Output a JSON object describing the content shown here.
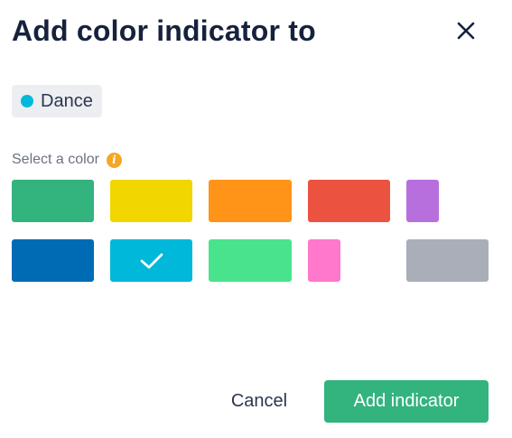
{
  "dialog": {
    "title": "Add color indicator to",
    "close_icon": "close-icon"
  },
  "tag": {
    "label": "Dance",
    "dot_color": "#00b8d9"
  },
  "color_section": {
    "label": "Select a color",
    "info_icon": "info-icon",
    "info_glyph": "i"
  },
  "colors": [
    {
      "name": "green",
      "hex": "#33b37e",
      "selected": false
    },
    {
      "name": "yellow",
      "hex": "#f2d600",
      "selected": false
    },
    {
      "name": "orange",
      "hex": "#ff9418",
      "selected": false
    },
    {
      "name": "red",
      "hex": "#eb5340",
      "selected": false
    },
    {
      "name": "purple",
      "hex": "#b86fde",
      "selected": false
    },
    {
      "name": "blue",
      "hex": "#006bb5",
      "selected": false
    },
    {
      "name": "cyan",
      "hex": "#00b8d9",
      "selected": true
    },
    {
      "name": "mint",
      "hex": "#49e38d",
      "selected": false
    },
    {
      "name": "pink",
      "hex": "#ff78cb",
      "selected": false
    },
    {
      "name": "gray",
      "hex": "#a9aeb9",
      "selected": false
    }
  ],
  "buttons": {
    "cancel_label": "Cancel",
    "add_label": "Add indicator"
  }
}
